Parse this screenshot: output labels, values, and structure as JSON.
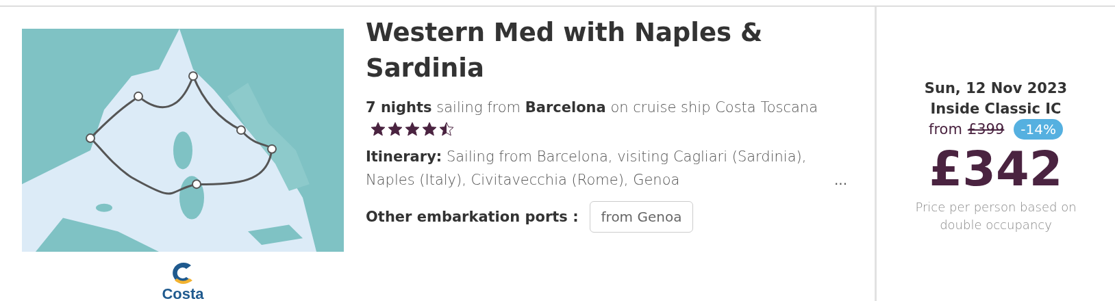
{
  "cruise": {
    "logo": {
      "text": "Costa"
    },
    "title": "Western Med with Naples & Sardinia",
    "summary": "**7 nights** sailing from **Barcelona** on cruise ship Costa Toscana",
    "stars": 4.5,
    "itinerary": "**Itinerary:** Sailing from Barcelona, visiting Cagliari (Sardinia), Naples (Italy), Civitavecchia (Rome), Genoa",
    "more": "...",
    "ports_label": "Other embarkation ports :",
    "ports": [
      "from Genoa"
    ]
  },
  "price": {
    "date": "Sun, 12 Nov 2023",
    "cabin": "Inside Classic IC",
    "from_label": "from",
    "was_price": "£399",
    "discount": "-14%",
    "amount": "£342",
    "note": "Price per person based on double occupancy"
  }
}
